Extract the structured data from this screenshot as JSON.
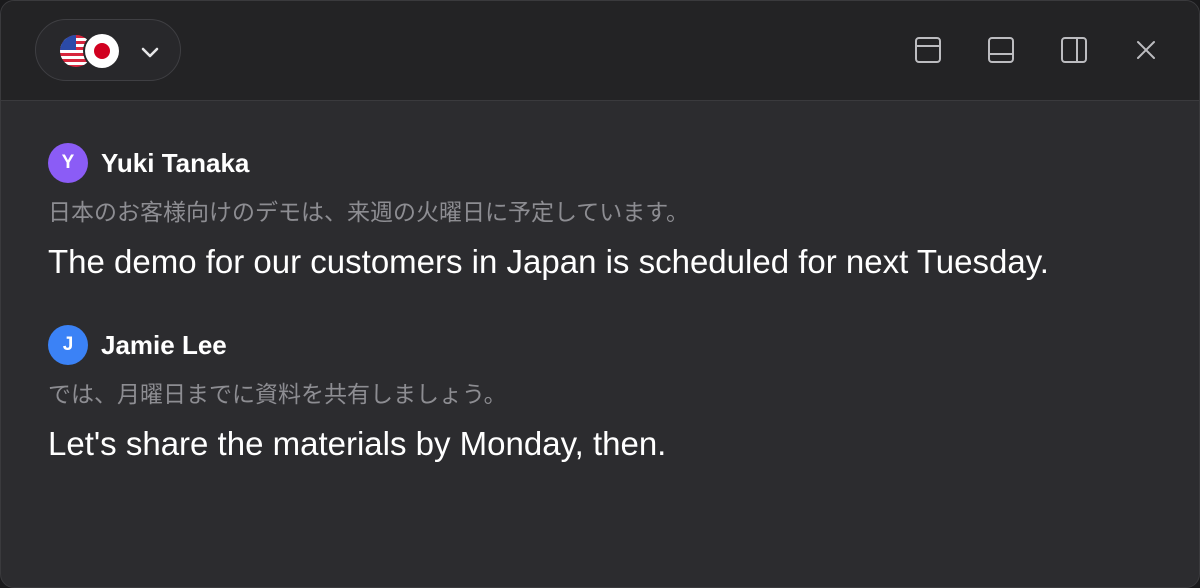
{
  "toolbar": {
    "language_picker": {
      "source_flag": "us-flag-icon",
      "target_flag": "japan-flag-icon",
      "chevron": "chevron-down-icon"
    },
    "buttons": [
      {
        "name": "layout-top-panel-icon"
      },
      {
        "name": "layout-bottom-panel-icon"
      },
      {
        "name": "layout-side-panel-icon"
      },
      {
        "name": "close-icon"
      }
    ]
  },
  "messages": [
    {
      "author": "Yuki Tanaka",
      "avatar_initial": "Y",
      "avatar_color": "#8b5cf6",
      "original": "日本のお客様向けのデモは、来週の火曜日に予定しています。",
      "translation": "The demo for our customers in Japan is scheduled for next Tuesday."
    },
    {
      "author": "Jamie Lee",
      "avatar_initial": "J",
      "avatar_color": "#3b82f6",
      "original": "では、月曜日までに資料を共有しましょう。",
      "translation": "Let's share the materials by Monday, then."
    }
  ],
  "colors": {
    "window_bg": "#2c2c2f",
    "titlebar_bg": "#232325",
    "original_text": "#8d8d92",
    "translation_text": "#ffffff"
  }
}
